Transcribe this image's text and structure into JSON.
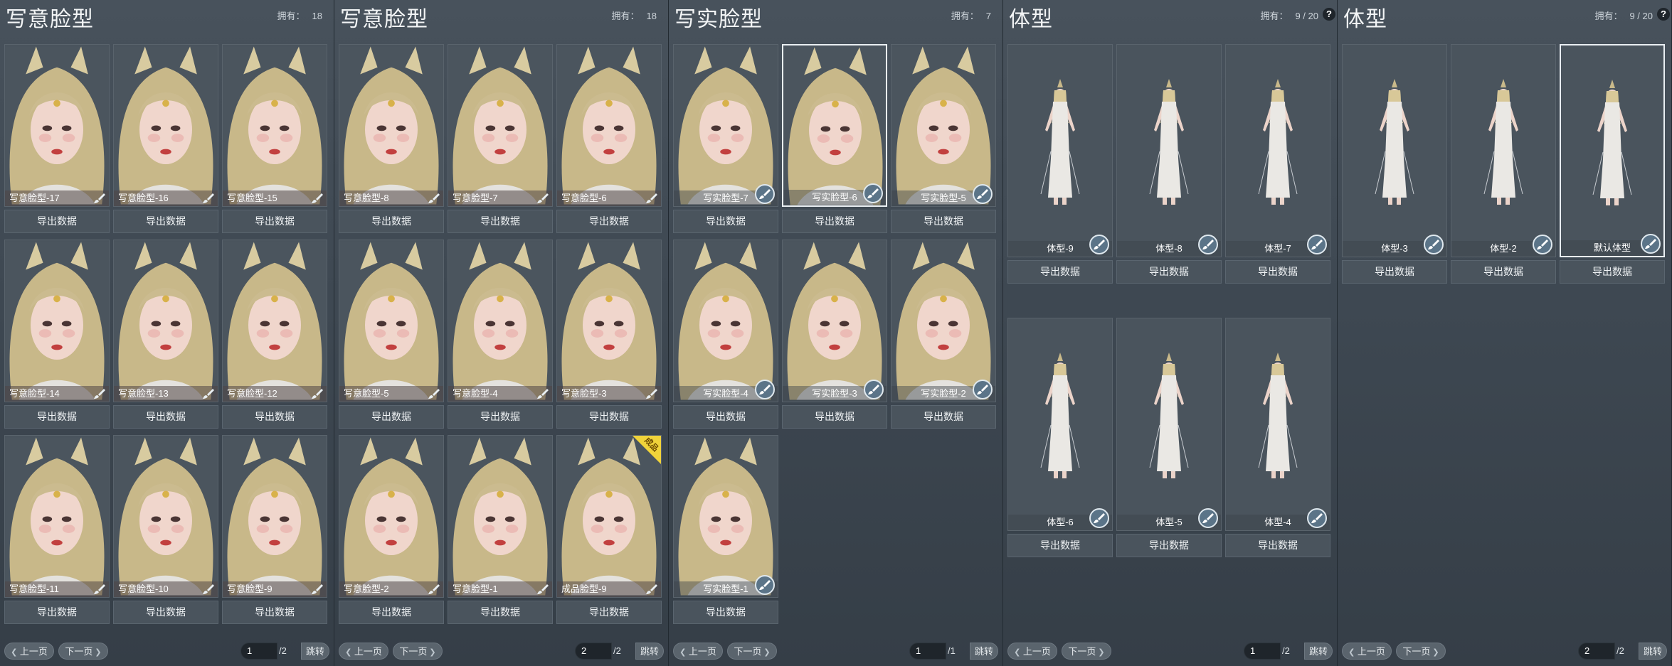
{
  "panels": [
    {
      "title": "写意脸型",
      "own_label": "拥有：",
      "own_value": "18",
      "help": "",
      "items": [
        {
          "label": "写意脸型-17"
        },
        {
          "label": "写意脸型-16"
        },
        {
          "label": "写意脸型-15"
        },
        {
          "label": "写意脸型-14"
        },
        {
          "label": "写意脸型-13"
        },
        {
          "label": "写意脸型-12"
        },
        {
          "label": "写意脸型-11"
        },
        {
          "label": "写意脸型-10"
        },
        {
          "label": "写意脸型-9"
        }
      ],
      "export_label": "导出数据",
      "pager": {
        "prev": "上一页",
        "next": "下一页",
        "page": "1",
        "total": "/2",
        "jump": "跳转"
      }
    },
    {
      "title": "写意脸型",
      "own_label": "拥有：",
      "own_value": "18",
      "help": "",
      "items": [
        {
          "label": "写意脸型-8"
        },
        {
          "label": "写意脸型-7"
        },
        {
          "label": "写意脸型-6"
        },
        {
          "label": "写意脸型-5"
        },
        {
          "label": "写意脸型-4"
        },
        {
          "label": "写意脸型-3"
        },
        {
          "label": "写意脸型-2"
        },
        {
          "label": "写意脸型-1"
        },
        {
          "label": "成品脸型-9",
          "badge": "成品"
        }
      ],
      "export_label": "导出数据",
      "pager": {
        "prev": "上一页",
        "next": "下一页",
        "page": "2",
        "total": "/2",
        "jump": "跳转"
      }
    },
    {
      "title": "写实脸型",
      "own_label": "拥有：",
      "own_value": "7",
      "help": "",
      "items": [
        {
          "label": "写实脸型-7"
        },
        {
          "label": "写实脸型-6",
          "selected": true
        },
        {
          "label": "写实脸型-5"
        },
        {
          "label": "写实脸型-4"
        },
        {
          "label": "写实脸型-3"
        },
        {
          "label": "写实脸型-2"
        },
        {
          "label": "写实脸型-1"
        }
      ],
      "export_label": "导出数据",
      "pager": {
        "prev": "上一页",
        "next": "下一页",
        "page": "1",
        "total": "/1",
        "jump": "跳转"
      }
    },
    {
      "title": "体型",
      "own_label": "拥有：",
      "own_value": "9 / 20",
      "help": "?",
      "items": [
        {
          "label": "体型-9"
        },
        {
          "label": "体型-8"
        },
        {
          "label": "体型-7"
        },
        {
          "label": "体型-6"
        },
        {
          "label": "体型-5"
        },
        {
          "label": "体型-4"
        }
      ],
      "export_label": "导出数据",
      "pager": {
        "prev": "上一页",
        "next": "下一页",
        "page": "1",
        "total": "/2",
        "jump": "跳转"
      }
    },
    {
      "title": "体型",
      "own_label": "拥有：",
      "own_value": "9 / 20",
      "help": "?",
      "items": [
        {
          "label": "体型-3"
        },
        {
          "label": "体型-2"
        },
        {
          "label": "默认体型",
          "selected": true
        }
      ],
      "export_label": "导出数据",
      "pager": {
        "prev": "上一页",
        "next": "下一页",
        "page": "2",
        "total": "/2",
        "jump": "跳转"
      }
    }
  ]
}
